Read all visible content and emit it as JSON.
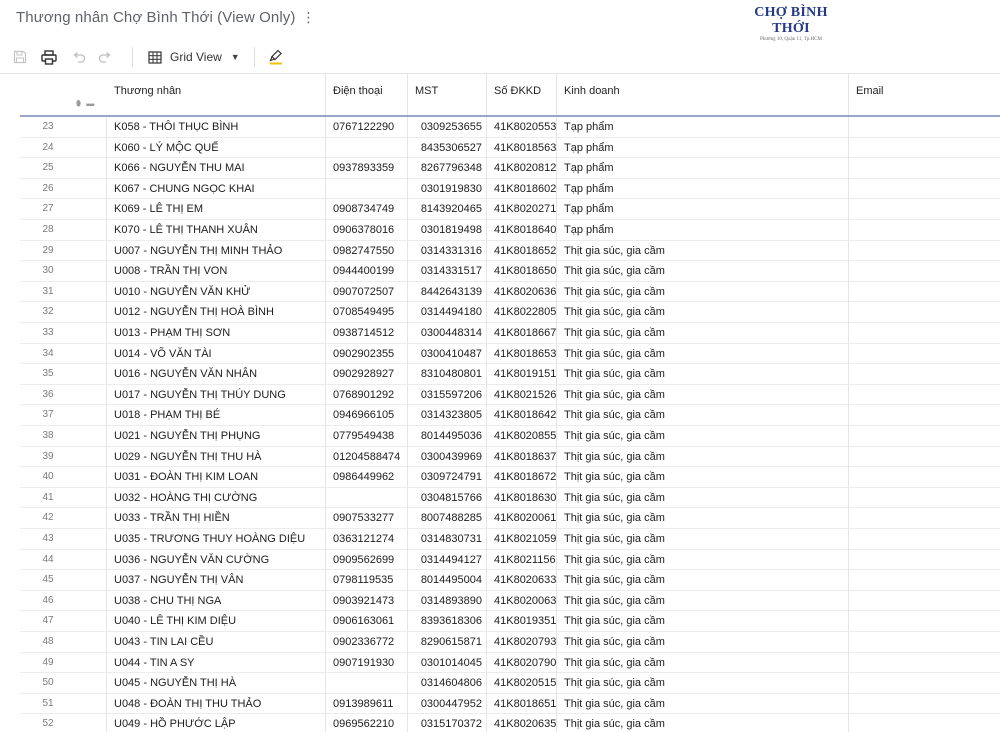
{
  "window": {
    "title": "Thương nhân Chợ Bình Thới (View Only)"
  },
  "brand": {
    "name": "CHỢ BÌNH THỚI",
    "address": "Phường 10, Quận 11, Tp.HCM"
  },
  "toolbar": {
    "icons": [
      "save-icon",
      "print-icon",
      "undo-icon",
      "redo-icon",
      "grid-icon",
      "caret-down-icon",
      "highlighter-icon"
    ],
    "view_label": "Grid View"
  },
  "table": {
    "columns": [
      "Thương nhân",
      "Điện thoại",
      "MST",
      "Số ĐKKD",
      "Kinh doanh",
      "Email"
    ],
    "rows": [
      [
        "23",
        "K058 - THÔI THỤC BÌNH",
        "0767122290",
        "0309253655",
        "41K8020553",
        "Tạp phẩm",
        ""
      ],
      [
        "24",
        "K060 - LÝ MỘC QUẾ",
        "",
        "8435306527",
        "41K8018563",
        "Tạp phẩm",
        ""
      ],
      [
        "25",
        "K066 - NGUYỄN THU MAI",
        "0937893359",
        "8267796348",
        "41K8020812",
        "Tạp phẩm",
        ""
      ],
      [
        "26",
        "K067 - CHUNG NGỌC KHAI",
        "",
        "0301919830",
        "41K8018602",
        "Tạp phẩm",
        ""
      ],
      [
        "27",
        "K069 - LÊ THỊ EM",
        "0908734749",
        "8143920465",
        "41K8020271",
        "Tạp phẩm",
        ""
      ],
      [
        "28",
        "K070 - LÊ THỊ THANH XUÂN",
        "0906378016",
        "0301819498",
        "41K8018640",
        "Tạp phẩm",
        ""
      ],
      [
        "29",
        "U007 - NGUYỄN THỊ MINH THẢO",
        "0982747550",
        "0314331316",
        "41K8018652",
        "Thịt gia súc, gia cầm",
        ""
      ],
      [
        "30",
        "U008 - TRẦN THỊ VON",
        "0944400199",
        "0314331517",
        "41K8018650",
        "Thịt gia súc, gia cầm",
        ""
      ],
      [
        "31",
        "U010 - NGUYỄN VĂN KHỬ",
        "0907072507",
        "8442643139",
        "41K8020636",
        "Thịt gia súc, gia cầm",
        ""
      ],
      [
        "32",
        "U012 - NGUYỄN THỊ HOÀ BÌNH",
        "0708549495",
        "0314494180",
        "41K8022805",
        "Thịt gia súc, gia cầm",
        ""
      ],
      [
        "33",
        "U013 - PHẠM THỊ SƠN",
        "0938714512",
        "0300448314",
        "41K8018667",
        "Thịt gia súc, gia cầm",
        ""
      ],
      [
        "34",
        "U014 - VÕ VĂN TÀI",
        "0902902355",
        "0300410487",
        "41K8018653",
        "Thịt gia súc, gia cầm",
        ""
      ],
      [
        "35",
        "U016 - NGUYỄN VĂN NHÂN",
        "0902928927",
        "8310480801",
        "41K8019151",
        "Thịt gia súc, gia cầm",
        ""
      ],
      [
        "36",
        "U017 - NGUYỄN THỊ THÚY DUNG",
        "0768901292",
        "0315597206",
        "41K8021526",
        "Thịt gia súc, gia cầm",
        ""
      ],
      [
        "37",
        "U018 - PHẠM THỊ BÉ",
        "0946966105",
        "0314323805",
        "41K8018642",
        "Thịt gia súc, gia cầm",
        ""
      ],
      [
        "38",
        "U021 - NGUYỄN THỊ PHỤNG",
        "0779549438",
        "8014495036",
        "41K8020855",
        "Thịt gia súc, gia cầm",
        ""
      ],
      [
        "39",
        "U029 - NGUYỄN THỊ THU HÀ",
        "01204588474",
        "0300439969",
        "41K8018637",
        "Thịt gia súc, gia cầm",
        ""
      ],
      [
        "40",
        "U031 - ĐOÀN THỊ KIM LOAN",
        "0986449962",
        "0309724791",
        "41K8018672",
        "Thịt gia súc, gia cầm",
        ""
      ],
      [
        "41",
        "U032 - HOÀNG THỊ CƯỜNG",
        "",
        "0304815766",
        "41K8018630",
        "Thịt gia súc, gia cầm",
        ""
      ],
      [
        "42",
        "U033 - TRẦN THỊ HIỀN",
        "0907533277",
        "8007488285",
        "41K8020061",
        "Thịt gia súc, gia cầm",
        ""
      ],
      [
        "43",
        "U035 - TRƯƠNG THUY HOÀNG DIỆU",
        "0363121274",
        "0314830731",
        "41K8021059",
        "Thịt gia súc, gia cầm",
        ""
      ],
      [
        "44",
        "U036 - NGUYỄN VĂN CƯỜNG",
        "0909562699",
        "0314494127",
        "41K8021156",
        "Thịt gia súc, gia cầm",
        ""
      ],
      [
        "45",
        "U037 - NGUYỄN THỊ VÂN",
        "0798119535",
        "8014495004",
        "41K8020633",
        "Thịt gia súc, gia cầm",
        ""
      ],
      [
        "46",
        "U038 - CHU THỊ NGA",
        "0903921473",
        "0314893890",
        "41K8020063",
        "Thịt gia súc, gia cầm",
        ""
      ],
      [
        "47",
        "U040 - LÊ THỊ KIM DIỆU",
        "0906163061",
        "8393618306",
        "41K8019351",
        "Thịt gia súc, gia cầm",
        ""
      ],
      [
        "48",
        "U043 - TIN LAI CỀU",
        "0902336772",
        "8290615871",
        "41K8020793",
        "Thịt gia súc, gia cầm",
        ""
      ],
      [
        "49",
        "U044 - TIN A SY",
        "0907191930",
        "0301014045",
        "41K8020790",
        "Thịt gia súc, gia cầm",
        ""
      ],
      [
        "50",
        "U045 - NGUYỄN THỊ HÀ",
        "",
        "0314604806",
        "41K8020515",
        "Thịt gia súc, gia cầm",
        ""
      ],
      [
        "51",
        "U048 - ĐOÀN THỊ THU THẢO",
        "0913989611",
        "0300447952",
        "41K8018651",
        "Thịt gia súc, gia cầm",
        ""
      ],
      [
        "52",
        "U049 - HỒ PHƯỚC LẬP",
        "0969562210",
        "0315170372",
        "41K8020635",
        "Thịt gia súc, gia cầm",
        ""
      ]
    ]
  }
}
